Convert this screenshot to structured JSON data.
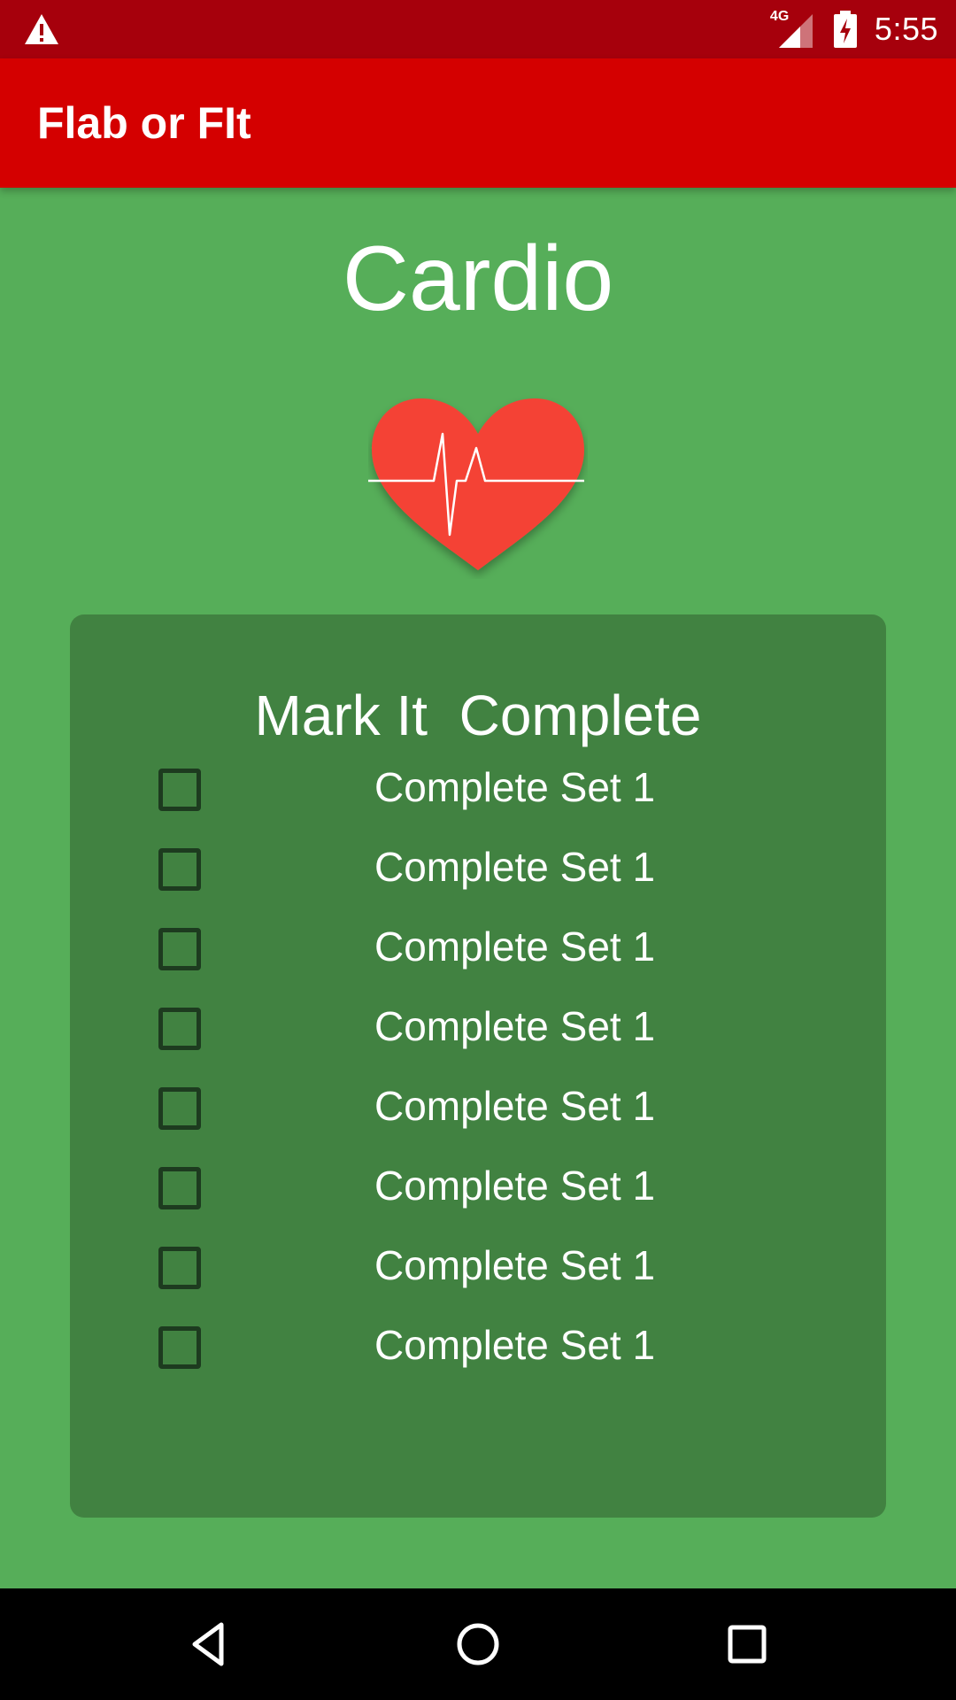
{
  "status_bar": {
    "network": "4G",
    "time": "5:55",
    "icons": [
      "warning-icon",
      "signal-icon",
      "battery-charging-icon"
    ]
  },
  "app_bar": {
    "title": "Flab or FIt"
  },
  "page": {
    "heading": "Cardio",
    "image": "heart-rate-icon"
  },
  "card": {
    "title": "Mark It  Complete",
    "items": [
      {
        "label": "Complete Set 1",
        "checked": false
      },
      {
        "label": "Complete Set 1",
        "checked": false
      },
      {
        "label": "Complete Set 1",
        "checked": false
      },
      {
        "label": "Complete Set 1",
        "checked": false
      },
      {
        "label": "Complete Set 1",
        "checked": false
      },
      {
        "label": "Complete Set 1",
        "checked": false
      },
      {
        "label": "Complete Set 1",
        "checked": false
      },
      {
        "label": "Complete Set 1",
        "checked": false
      }
    ]
  },
  "nav_bar": {
    "icons": [
      "back-icon",
      "home-icon",
      "recents-icon"
    ]
  },
  "colors": {
    "status_bar": "#a6000c",
    "app_bar": "#d40000",
    "background": "#56ae59",
    "card": "#418241",
    "heart": "#f44336"
  }
}
